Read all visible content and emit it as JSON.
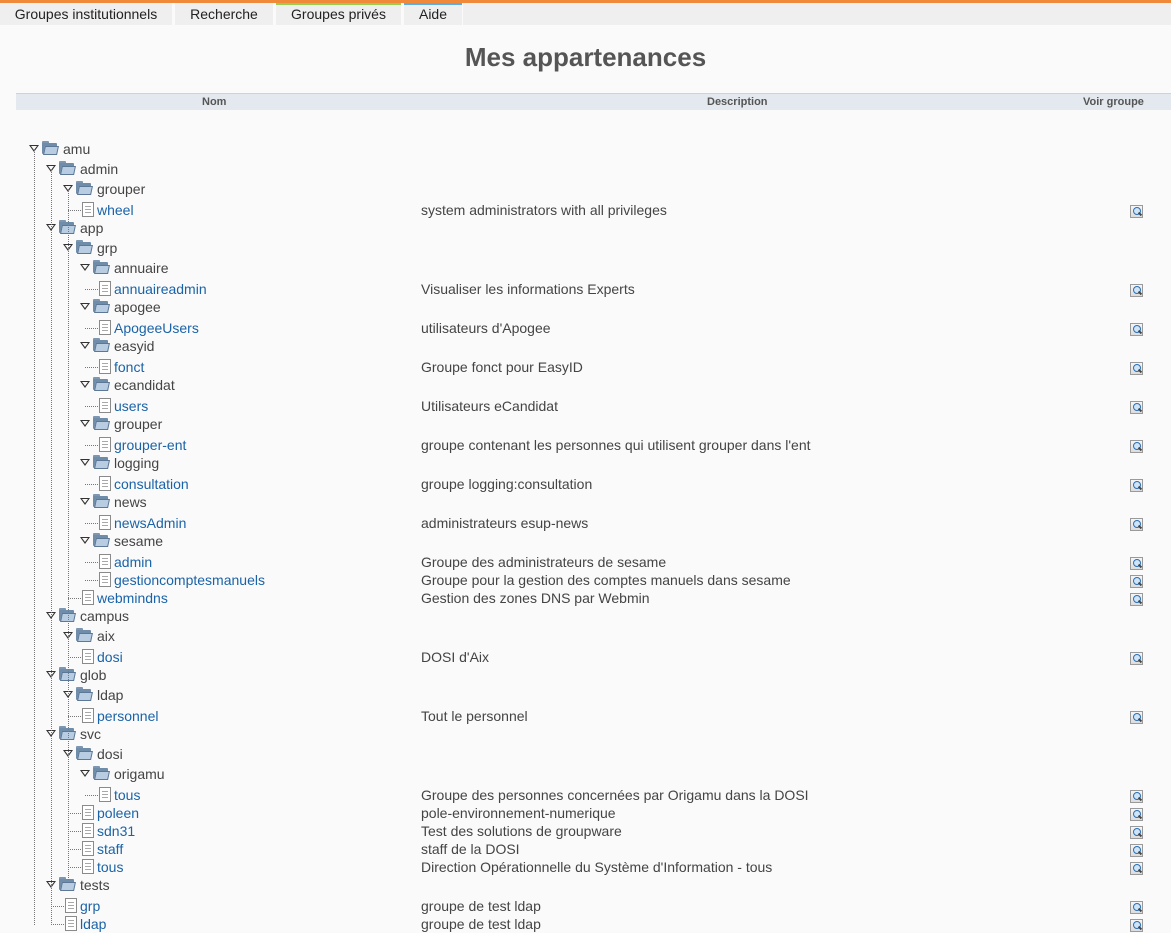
{
  "nav": {
    "tabs": [
      {
        "label": "Groupes institutionnels",
        "accent": "#f08a3a"
      },
      {
        "label": "Recherche",
        "accent": "#efefef"
      },
      {
        "label": "Groupes privés",
        "accent": "#9acd50"
      },
      {
        "label": "Aide",
        "accent": "#5aaee8"
      }
    ]
  },
  "page": {
    "title": "Mes appartenances"
  },
  "table": {
    "headers": {
      "name": "Nom",
      "description": "Description",
      "view": "Voir groupe"
    },
    "rows": [
      {
        "type": "folder",
        "depth": 0,
        "name": "amu"
      },
      {
        "type": "folder",
        "depth": 1,
        "name": "admin"
      },
      {
        "type": "folder",
        "depth": 2,
        "name": "grouper"
      },
      {
        "type": "group",
        "depth": 3,
        "name": "wheel",
        "desc": "system administrators with all privileges"
      },
      {
        "type": "folder",
        "depth": 1,
        "name": "app"
      },
      {
        "type": "folder",
        "depth": 2,
        "name": "grp"
      },
      {
        "type": "folder",
        "depth": 3,
        "name": "annuaire"
      },
      {
        "type": "group",
        "depth": 4,
        "name": "annuaireadmin",
        "desc": "Visualiser les informations Experts"
      },
      {
        "type": "folder",
        "depth": 3,
        "name": "apogee"
      },
      {
        "type": "group",
        "depth": 4,
        "name": "ApogeeUsers",
        "desc": "utilisateurs d'Apogee"
      },
      {
        "type": "folder",
        "depth": 3,
        "name": "easyid"
      },
      {
        "type": "group",
        "depth": 4,
        "name": "fonct",
        "desc": "Groupe fonct pour EasyID"
      },
      {
        "type": "folder",
        "depth": 3,
        "name": "ecandidat"
      },
      {
        "type": "group",
        "depth": 4,
        "name": "users",
        "desc": "Utilisateurs eCandidat"
      },
      {
        "type": "folder",
        "depth": 3,
        "name": "grouper"
      },
      {
        "type": "group",
        "depth": 4,
        "name": "grouper-ent",
        "desc": "groupe contenant les personnes qui utilisent grouper dans l'ent"
      },
      {
        "type": "folder",
        "depth": 3,
        "name": "logging"
      },
      {
        "type": "group",
        "depth": 4,
        "name": "consultation",
        "desc": "groupe logging:consultation"
      },
      {
        "type": "folder",
        "depth": 3,
        "name": "news"
      },
      {
        "type": "group",
        "depth": 4,
        "name": "newsAdmin",
        "desc": "administrateurs esup-news"
      },
      {
        "type": "folder",
        "depth": 3,
        "name": "sesame"
      },
      {
        "type": "group",
        "depth": 4,
        "name": "admin",
        "desc": "Groupe des administrateurs de sesame"
      },
      {
        "type": "group",
        "depth": 4,
        "name": "gestioncomptesmanuels",
        "desc": "Groupe pour la gestion des comptes manuels dans sesame"
      },
      {
        "type": "group",
        "depth": 3,
        "name": "webmindns",
        "desc": "Gestion des zones DNS par Webmin"
      },
      {
        "type": "folder",
        "depth": 1,
        "name": "campus"
      },
      {
        "type": "folder",
        "depth": 2,
        "name": "aix"
      },
      {
        "type": "group",
        "depth": 3,
        "name": "dosi",
        "desc": "DOSI d'Aix"
      },
      {
        "type": "folder",
        "depth": 1,
        "name": "glob"
      },
      {
        "type": "folder",
        "depth": 2,
        "name": "ldap"
      },
      {
        "type": "group",
        "depth": 3,
        "name": "personnel",
        "desc": "Tout le personnel"
      },
      {
        "type": "folder",
        "depth": 1,
        "name": "svc"
      },
      {
        "type": "folder",
        "depth": 2,
        "name": "dosi"
      },
      {
        "type": "folder",
        "depth": 3,
        "name": "origamu"
      },
      {
        "type": "group",
        "depth": 4,
        "name": "tous",
        "desc": "Groupe des personnes concernées par Origamu dans la DOSI"
      },
      {
        "type": "group",
        "depth": 3,
        "name": "poleen",
        "desc": "pole-environnement-numerique"
      },
      {
        "type": "group",
        "depth": 3,
        "name": "sdn31",
        "desc": "Test des solutions de groupware"
      },
      {
        "type": "group",
        "depth": 3,
        "name": "staff",
        "desc": "staff de la DOSI"
      },
      {
        "type": "group",
        "depth": 3,
        "name": "tous",
        "desc": "Direction Opérationnelle du Système d'Information - tous"
      },
      {
        "type": "folder",
        "depth": 1,
        "name": "tests"
      },
      {
        "type": "group",
        "depth": 2,
        "name": "grp",
        "desc": "groupe de test ldap"
      },
      {
        "type": "group",
        "depth": 2,
        "name": "ldap",
        "desc": "groupe de test ldap"
      }
    ]
  }
}
